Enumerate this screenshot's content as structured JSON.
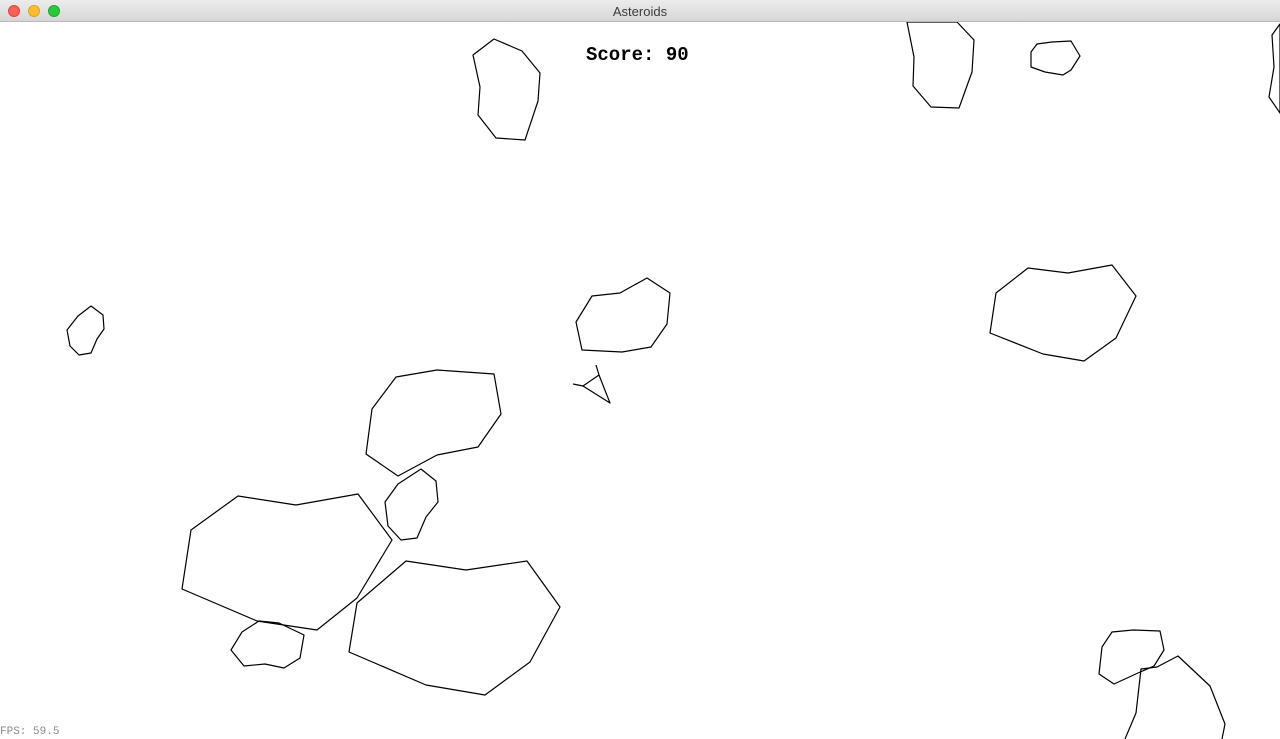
{
  "window": {
    "title": "Asteroids",
    "controls": [
      "close-button",
      "minimize-button",
      "zoom-button"
    ]
  },
  "hud": {
    "score_label": "Score:",
    "score_value": "90",
    "fps_label": "FPS:",
    "fps_value": "59.5"
  },
  "colors": {
    "background": "#ffffff",
    "stroke": "#000000",
    "fps_text": "#8a8a8a"
  },
  "game": {
    "asteroid_count": 16,
    "ship_count": 1
  }
}
